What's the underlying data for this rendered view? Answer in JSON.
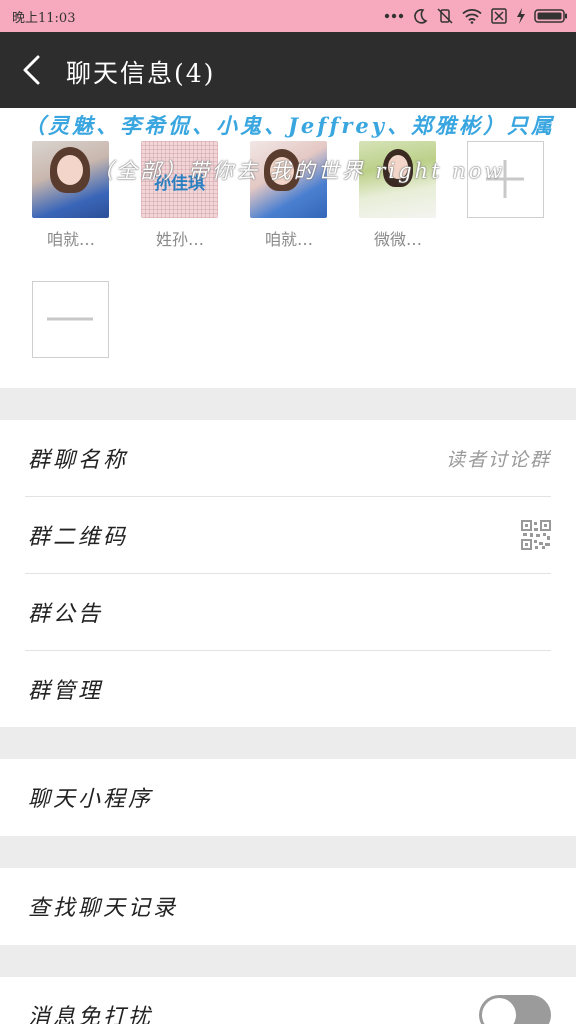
{
  "status_bar": {
    "time": "晚上11:03",
    "icons": [
      "more-dots-icon",
      "moon-icon",
      "vibrate-off-icon",
      "wifi-icon",
      "no-sim-icon",
      "charging-icon",
      "battery-icon"
    ]
  },
  "title_bar": {
    "title": "聊天信息(4)",
    "back_icon": "back-arrow-icon"
  },
  "members_panel": {
    "marquee_top": "（灵魅、李希侃、小鬼、Jeffrey、郑雅彬）只属",
    "marquee_overlay": "（全部）带你去 我的世界 right now",
    "members": [
      {
        "name": "咱就…",
        "avatar": "avatar-photo-girl-blue-hoodie"
      },
      {
        "name": "姓孙…",
        "avatar": "avatar-text-image",
        "avatar_text": "孙佳琪"
      },
      {
        "name": "咱就…",
        "avatar": "avatar-photo-girl-blue-hoodie"
      },
      {
        "name": "微微…",
        "avatar": "avatar-photo-girl-outdoor"
      }
    ],
    "add_icon": "plus-icon",
    "remove_icon": "minus-icon"
  },
  "settings": {
    "group_name_label": "群聊名称",
    "group_name_value": "读者讨论群",
    "qr_code_label": "群二维码",
    "qr_icon": "qr-code-icon",
    "announcement_label": "群公告",
    "manage_label": "群管理",
    "mini_program_label": "聊天小程序",
    "search_history_label": "查找聊天记录",
    "mute_label": "消息免打扰",
    "mute_enabled": false
  },
  "colors": {
    "status_bar_bg": "#f7a9bd",
    "title_bar_bg": "#2d2d2d",
    "marquee_top_color": "#3aa6e0",
    "page_bg": "#ececec"
  }
}
